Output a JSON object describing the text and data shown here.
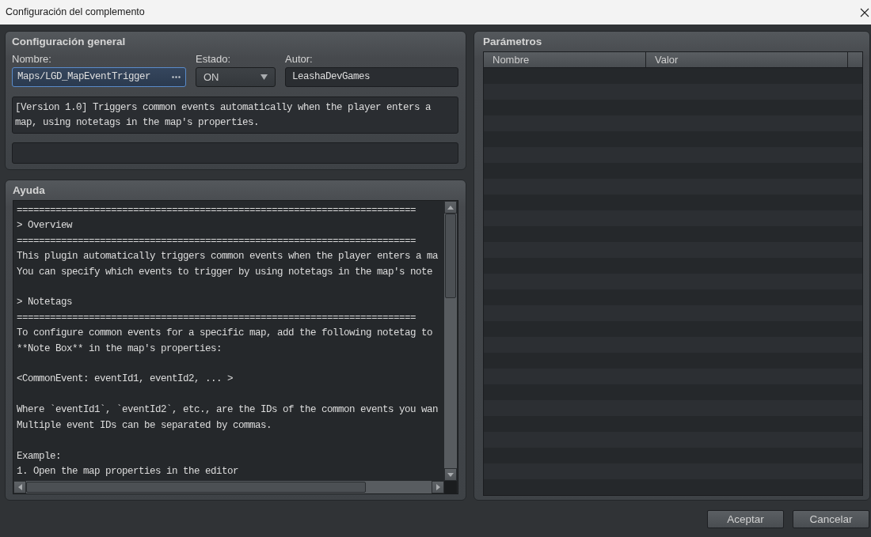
{
  "window": {
    "title": "Configuración del complemento"
  },
  "general": {
    "title": "Configuración general",
    "fields": [
      {
        "kind": "browse",
        "label": "Nombre:",
        "value": "Maps/LGD_MapEventTrigger",
        "focused": true
      },
      {
        "kind": "select",
        "label": "Estado:",
        "value": "ON",
        "focused": false
      },
      {
        "kind": "text",
        "label": "Autor:",
        "value": "LeashaDevGames",
        "focused": false
      }
    ],
    "description": "[Version 1.0] Triggers common events automatically when the player enters a map, using notetags in the map's properties."
  },
  "help": {
    "title": "Ayuda",
    "text": "========================================================================\n> Overview\n========================================================================\nThis plugin automatically triggers common events when the player enters a ma\nYou can specify which events to trigger by using notetags in the map's note\n\n> Notetags\n========================================================================\nTo configure common events for a specific map, add the following notetag to\n**Note Box** in the map's properties:\n\n<CommonEvent: eventId1, eventId2, ... >\n\nWhere `eventId1`, `eventId2`, etc., are the IDs of the common events you wan\nMultiple event IDs can be separated by commas.\n\nExample:\n1. Open the map properties in the editor"
  },
  "parameters": {
    "title": "Parámetros",
    "columns": [
      "Nombre",
      "Valor"
    ]
  },
  "buttons": [
    "Aceptar",
    "Cancelar"
  ]
}
